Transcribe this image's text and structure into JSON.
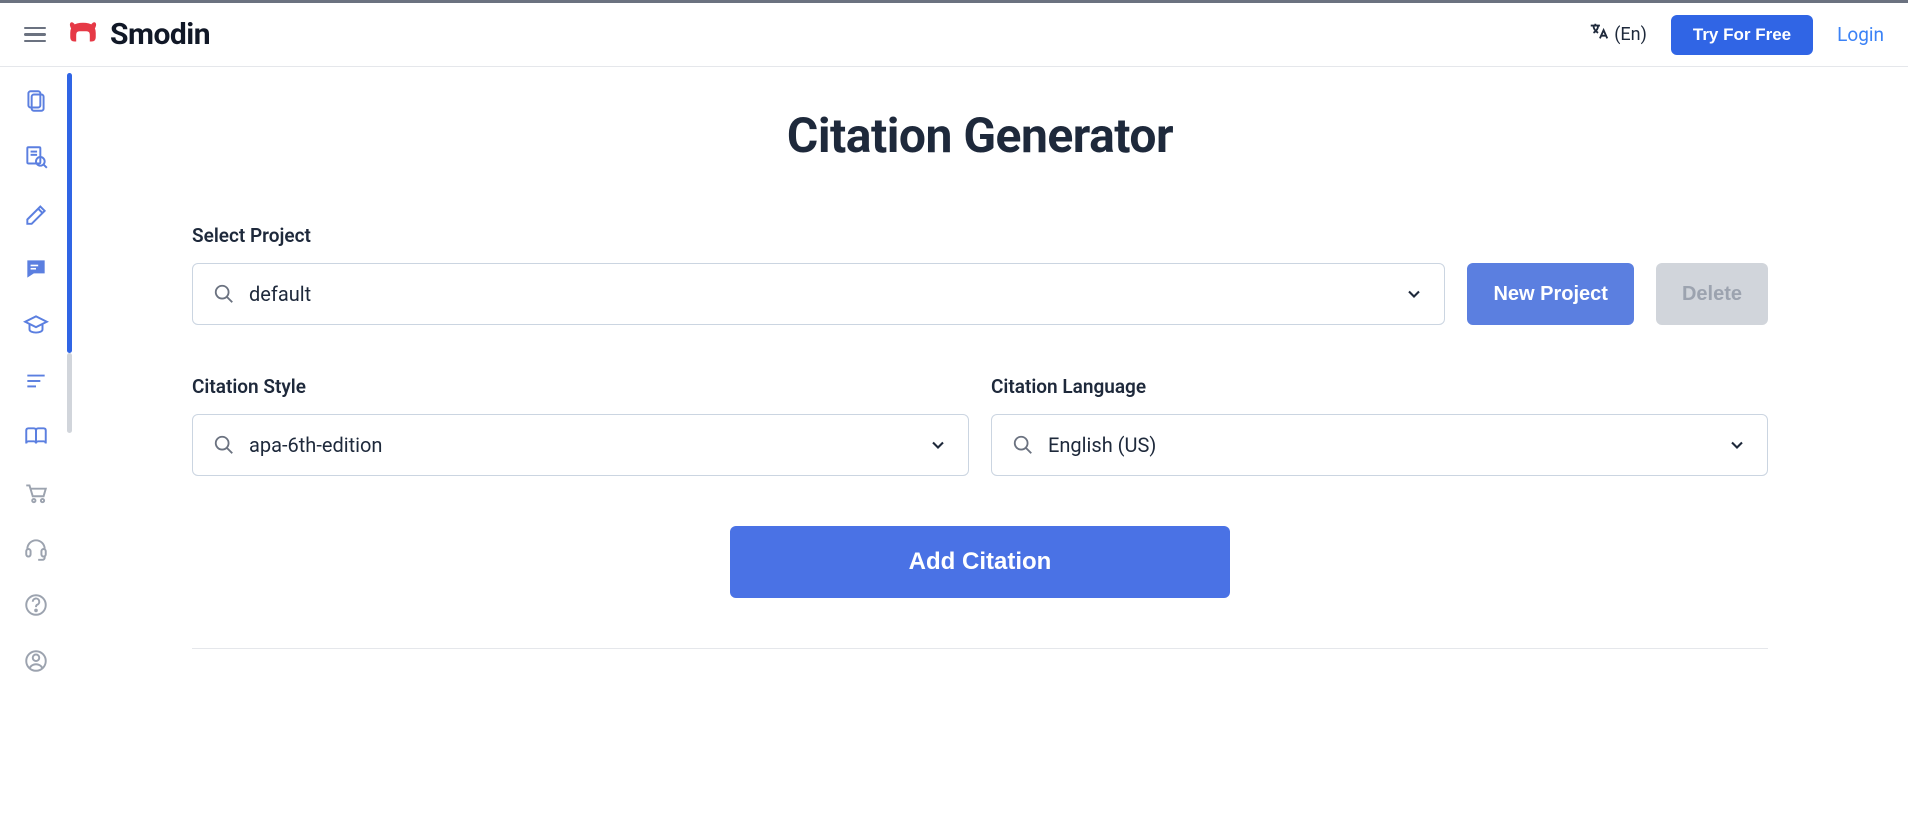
{
  "header": {
    "brand": "Smodin",
    "lang_label": "(En)",
    "try_free": "Try For Free",
    "login": "Login"
  },
  "page": {
    "title": "Citation Generator",
    "select_project_label": "Select Project",
    "project_value": "default",
    "new_project": "New Project",
    "delete": "Delete",
    "citation_style_label": "Citation Style",
    "citation_style_value": "apa-6th-edition",
    "citation_language_label": "Citation Language",
    "citation_language_value": "English (US)",
    "add_citation": "Add Citation"
  }
}
